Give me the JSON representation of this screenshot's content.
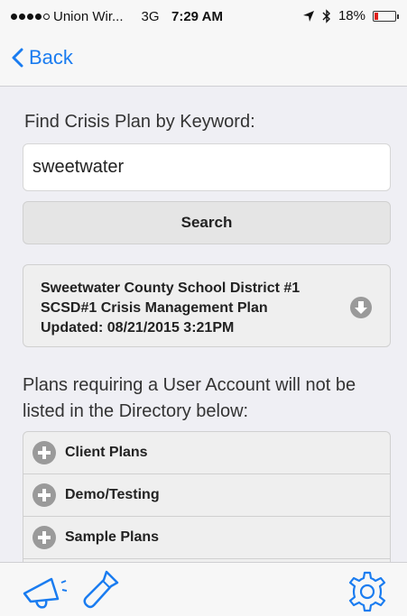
{
  "status_bar": {
    "carrier": "Union Wir...",
    "network": "3G",
    "time": "7:29 AM",
    "battery": "18%",
    "battery_level": 0.18,
    "icons": [
      "location-arrow-icon",
      "bluetooth-icon",
      "battery-icon"
    ]
  },
  "nav": {
    "back_label": "Back",
    "accent": "#1a7cf0"
  },
  "search": {
    "label": "Find Crisis Plan by Keyword:",
    "value": "sweetwater",
    "button_label": "Search"
  },
  "result": {
    "line1": "Sweetwater County School District #1",
    "line2": "SCSD#1 Crisis Management Plan",
    "line3": "Updated: 08/21/2015 3:21PM",
    "icon": "download-icon"
  },
  "notice": "Plans requiring a User Account will not be listed in the Directory below:",
  "directory": {
    "items": [
      {
        "label": "Client Plans",
        "icon": "expand-plus-icon"
      },
      {
        "label": "Demo/Testing",
        "icon": "expand-plus-icon"
      },
      {
        "label": "Sample Plans",
        "icon": "expand-plus-icon"
      }
    ]
  },
  "tab_bar": {
    "icons": [
      "megaphone-icon",
      "flashlight-icon",
      "gear-icon"
    ]
  }
}
